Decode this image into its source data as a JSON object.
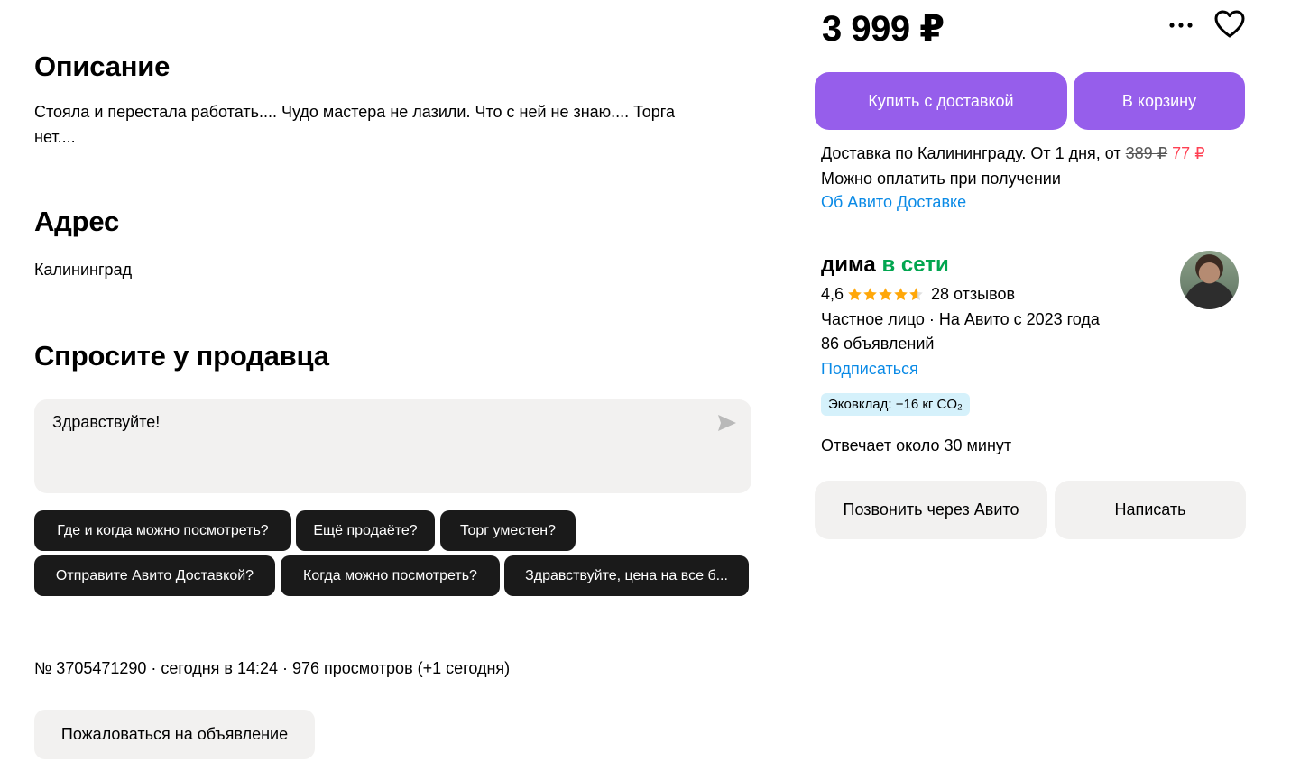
{
  "description": {
    "title": "Описание",
    "text_line1": "Стояла и перестала работать.... Чудо мастера не лазили. Что с ней не знаю.... Торга",
    "text_line2": "нет...."
  },
  "address": {
    "title": "Адрес",
    "value": "Калининград"
  },
  "ask_seller": {
    "title": "Спросите у продавца",
    "message": "Здравствуйте!",
    "chips": [
      "Где и когда можно посмотреть?",
      "Ещё продаёте?",
      "Торг уместен?",
      "Отправите Авито Доставкой?",
      "Когда можно посмотреть?",
      "Здравствуйте, цена на все б..."
    ]
  },
  "meta": {
    "line": "№ 3705471290 · сегодня в 14:24 · 976 просмотров (+1 сегодня)",
    "report_label": "Пожаловаться на объявление"
  },
  "price": "3 999 ₽",
  "buttons": {
    "buy_delivery": "Купить с доставкой",
    "to_cart": "В корзину",
    "call": "Позвонить через Авито",
    "write": "Написать"
  },
  "delivery": {
    "text": "Доставка по Калининграду. От 1 дня, от ",
    "old_price": "389 ₽",
    "new_price": "77 ₽",
    "pay_on_receipt": "Можно оплатить при получении",
    "about_link": "Об Авито Доставке"
  },
  "seller": {
    "name": "дима",
    "status": "в сети",
    "rating": "4,6",
    "stars": 4.6,
    "reviews": "28 отзывов",
    "type_line": "Частное лицо · На Авито с 2023 года",
    "ads_count": "86 объявлений",
    "subscribe": "Подписаться",
    "eco": "Эковклад: −16 кг CO₂",
    "response_time": "Отвечает около 30 минут"
  },
  "colors": {
    "purple": "#965eeb",
    "online_green": "#02a650",
    "link_blue": "#0a8ae6",
    "sale_red": "#ff4053",
    "star_orange": "#ffa709"
  },
  "icons": [
    "send-icon",
    "more-icon",
    "heart-icon",
    "star-icon",
    "avatar"
  ]
}
